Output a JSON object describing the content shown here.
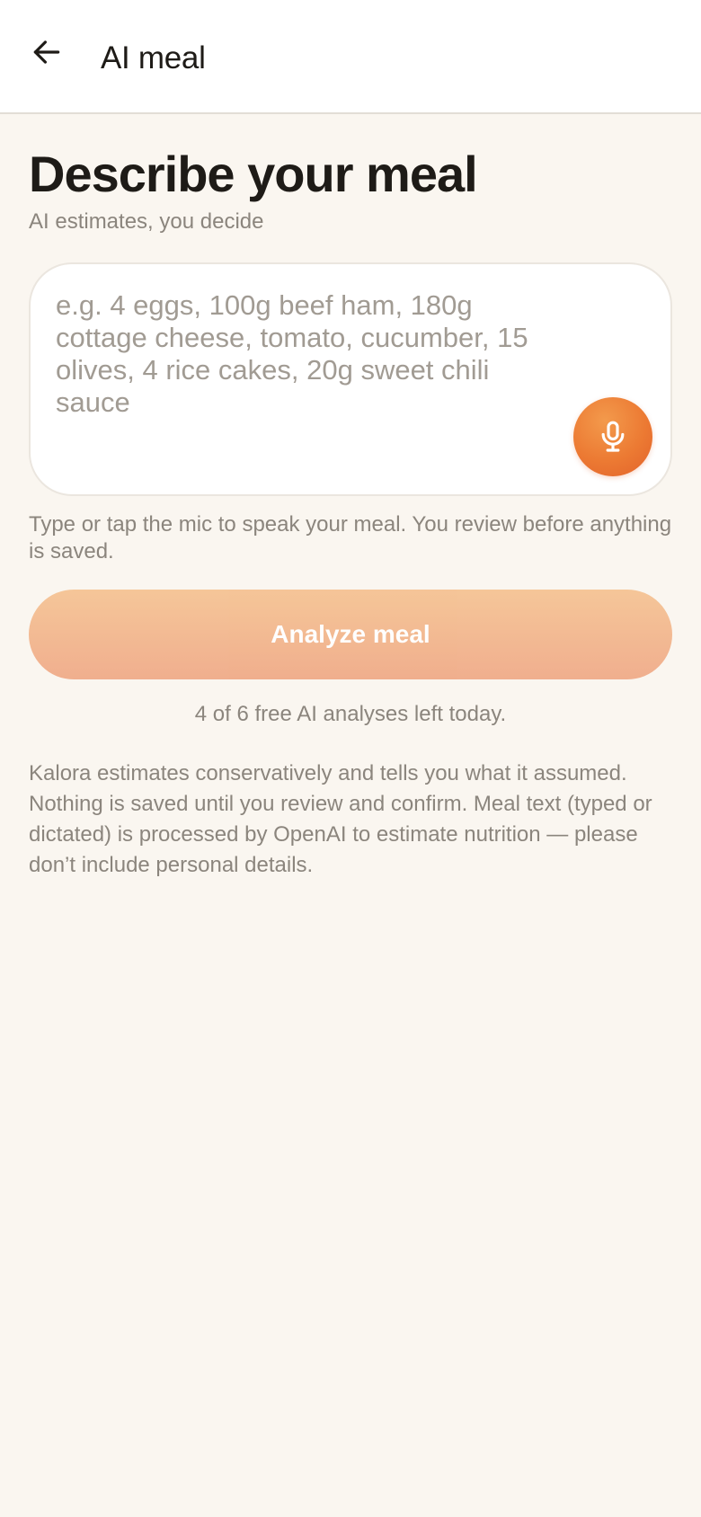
{
  "header": {
    "back_icon": "arrow-left-icon",
    "title": "AI meal"
  },
  "main": {
    "title": "Describe your meal",
    "subtitle": "AI estimates, you decide",
    "meal_input": {
      "value": "",
      "placeholder": "e.g. 4 eggs, 100g beef ham, 180g cottage cheese, tomato, cucumber, 15 olives, 4 rice cakes, 20g sweet chili sauce"
    },
    "mic_icon": "microphone-icon",
    "helper_text": "Type or tap the mic to speak your meal. You review before anything is saved.",
    "analyze_label": "Analyze meal",
    "quota_text": "4 of 6 free AI analyses left today.",
    "disclaimer": "Kalora estimates conservatively and tells you what it assumed. Nothing is saved until you review and confirm. Meal text (typed or dictated) is processed by OpenAI to estimate nutrition — please don’t include personal details."
  },
  "colors": {
    "accent": "#ec7a33",
    "button_disabled": "#f2b891",
    "background": "#faf6f0",
    "muted_text": "#8b857d"
  }
}
